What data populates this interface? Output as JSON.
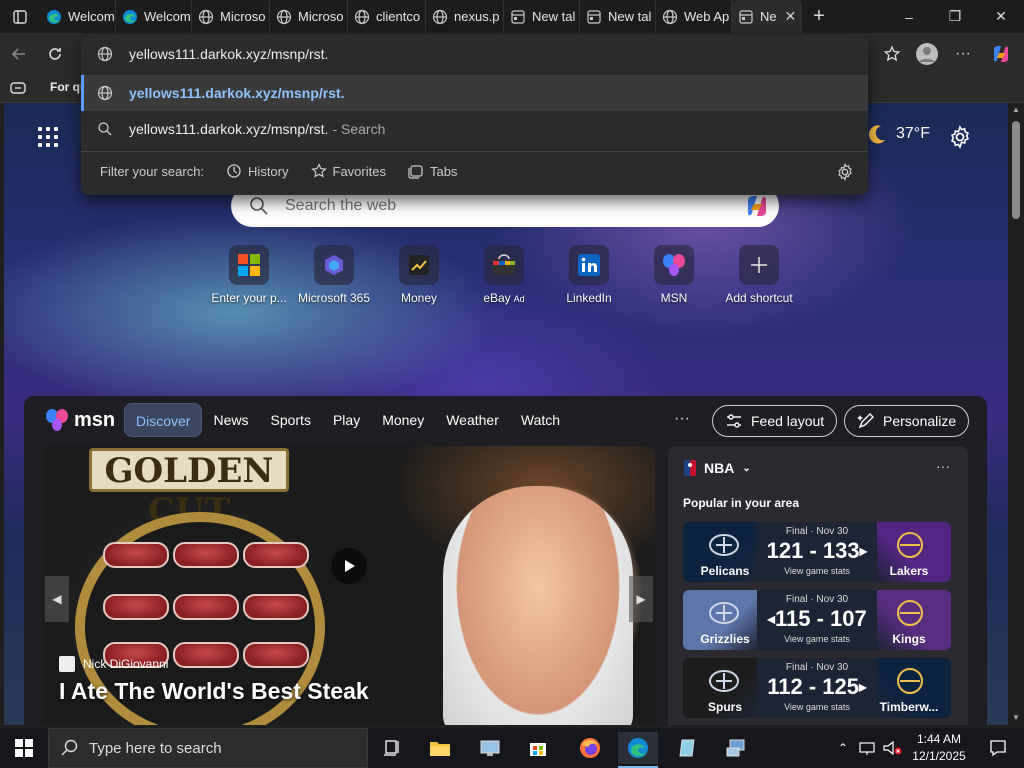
{
  "browser": {
    "tabs": [
      {
        "label": "Welcom",
        "icon": "edge-icon"
      },
      {
        "label": "Welcom",
        "icon": "edge-icon"
      },
      {
        "label": "Microso",
        "icon": "globe-icon"
      },
      {
        "label": "Microso",
        "icon": "globe-icon"
      },
      {
        "label": "clientco",
        "icon": "globe-icon"
      },
      {
        "label": "nexus.p",
        "icon": "globe-icon"
      },
      {
        "label": "New tal",
        "icon": "newtab-icon"
      },
      {
        "label": "New tal",
        "icon": "newtab-icon"
      },
      {
        "label": "Web Ap",
        "icon": "globe-icon"
      },
      {
        "label": "Ne",
        "icon": "newtab-icon",
        "active": true
      }
    ],
    "favorites_bar": {
      "item": "For qu"
    }
  },
  "omnibox": {
    "typed": "yellows111.darkok.xyz/msnp/rst.",
    "suggestions": [
      {
        "text": "yellows111.darkok.xyz/msnp/rst.",
        "icon": "globe-icon"
      },
      {
        "text": "yellows111.darkok.xyz/msnp/rst.",
        "suffix": "- Search",
        "icon": "search-icon"
      }
    ],
    "filter_label": "Filter your search:",
    "filters": [
      "History",
      "Favorites",
      "Tabs"
    ]
  },
  "newtab": {
    "weather": {
      "temp": "37°F"
    },
    "search_placeholder": "Search the web",
    "shortcuts": [
      {
        "label": "Enter your p...",
        "icon": "microsoft-icon"
      },
      {
        "label": "Microsoft 365",
        "icon": "m365-icon"
      },
      {
        "label": "Money",
        "icon": "money-icon"
      },
      {
        "label": "eBay",
        "ad": "Ad",
        "icon": "ebay-icon"
      },
      {
        "label": "LinkedIn",
        "icon": "linkedin-icon"
      },
      {
        "label": "MSN",
        "icon": "msn-icon"
      },
      {
        "label": "Add shortcut",
        "icon": "plus-icon"
      }
    ]
  },
  "feed": {
    "brand": "msn",
    "tabs": [
      "Discover",
      "News",
      "Sports",
      "Play",
      "Money",
      "Weather",
      "Watch"
    ],
    "active_tab": "Discover",
    "more": "···",
    "feed_layout": "Feed layout",
    "personalize": "Personalize",
    "hero": {
      "sign": "GOLDEN CUT",
      "author": "Nick DiGiovanni",
      "headline": "I Ate The World's Best Steak"
    },
    "nba": {
      "league": "NBA",
      "more": "···",
      "subtitle": "Popular in your area",
      "games": [
        {
          "status": "Final · Nov 30",
          "score": "121 - 133",
          "home": "Pelicans",
          "away": "Lakers",
          "stats": "View game stats",
          "winner_side": "right",
          "left_color": "#0c2340",
          "right_color": "#552583"
        },
        {
          "status": "Final · Nov 30",
          "score": "115 - 107",
          "home": "Grizzlies",
          "away": "Kings",
          "stats": "View game stats",
          "winner_side": "left",
          "left_color": "#5d76a9",
          "right_color": "#5a2d81"
        },
        {
          "status": "Final · Nov 30",
          "score": "112 - 125",
          "home": "Spurs",
          "away": "Timberw...",
          "stats": "View game stats",
          "winner_side": "right",
          "left_color": "#1c1c1c",
          "right_color": "#0c2340"
        }
      ]
    }
  },
  "taskbar": {
    "search_placeholder": "Type here to search",
    "time": "1:44 AM",
    "date": "12/1/2025"
  },
  "colors": {
    "accent": "#5b9cff",
    "link": "#8fc3ff"
  }
}
